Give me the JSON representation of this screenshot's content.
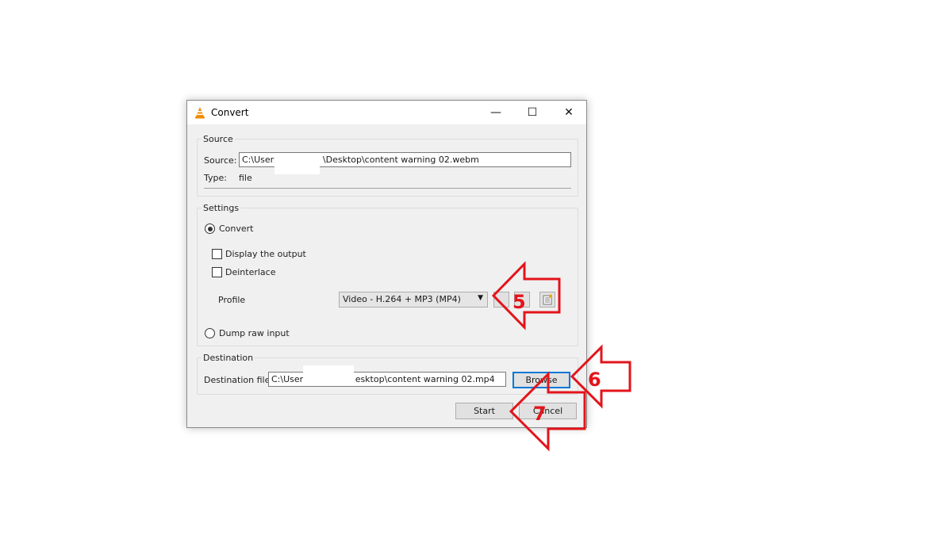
{
  "window": {
    "title": "Convert",
    "minimize_glyph": "—",
    "maximize_glyph": "☐",
    "close_glyph": "✕"
  },
  "source": {
    "group_title": "Source",
    "source_label": "Source:",
    "source_value_prefix": "C:\\Users",
    "source_value_suffix": "\\Desktop\\content warning 02.webm",
    "type_label": "Type:",
    "type_value": "file"
  },
  "settings": {
    "group_title": "Settings",
    "convert_label": "Convert",
    "convert_selected": true,
    "display_output_label": "Display the output",
    "display_output_checked": false,
    "deinterlace_label": "Deinterlace",
    "deinterlace_checked": false,
    "profile_label": "Profile",
    "profile_value": "Video - H.264 + MP3 (MP4)",
    "dump_raw_label": "Dump raw input",
    "dump_raw_selected": false
  },
  "destination": {
    "group_title": "Destination",
    "file_label": "Destination file:",
    "file_value_prefix": "C:\\User:",
    "file_value_suffix": "esktop\\content warning 02.mp4",
    "browse_label": "Browse"
  },
  "footer": {
    "start_label": "Start",
    "cancel_label": "Cancel"
  },
  "annotations": {
    "color": "#e3141b",
    "step5": "5",
    "step6": "6",
    "step7": "7"
  }
}
